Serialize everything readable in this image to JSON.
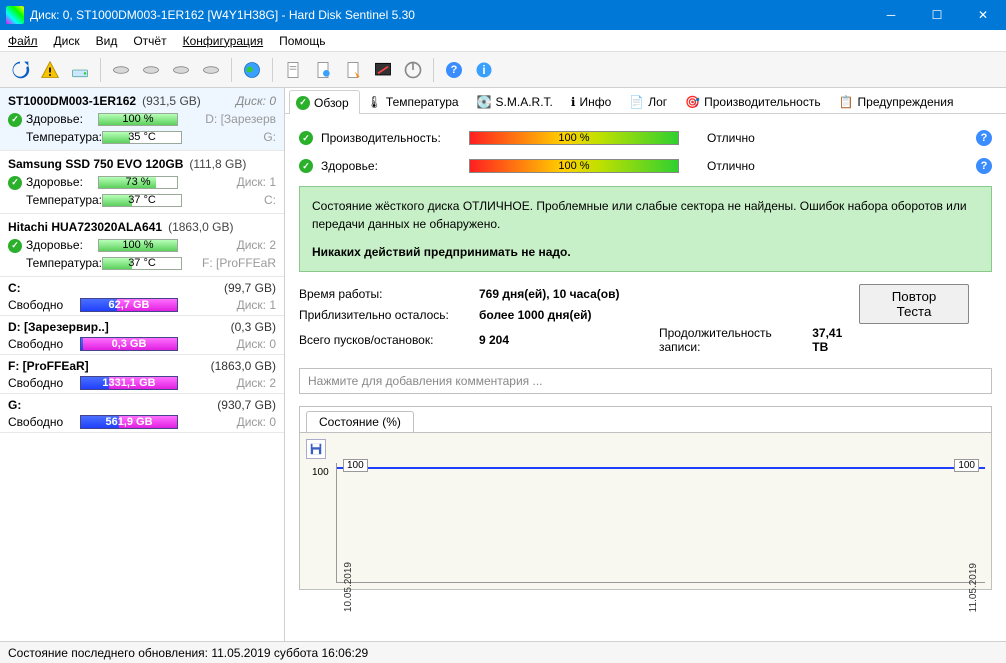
{
  "title": "Диск: 0, ST1000DM003-1ER162 [W4Y1H38G]  -  Hard Disk Sentinel 5.30",
  "menu": {
    "file": "Файл",
    "disk": "Диск",
    "view": "Вид",
    "report": "Отчёт",
    "config": "Конфигурация",
    "help": "Помощь"
  },
  "disks": [
    {
      "name": "ST1000DM003-1ER162",
      "size": "(931,5 GB)",
      "ord": "Диск: 0",
      "selected": true,
      "health_lbl": "Здоровье:",
      "health_val": "100 %",
      "health_pct": 100,
      "temp_lbl": "Температура:",
      "temp_val": "35 °C",
      "temp_pct": 35,
      "r1": "D: [Зарезерв",
      "r2": "G:"
    },
    {
      "name": "Samsung SSD 750 EVO 120GB",
      "size": "(111,8 GB)",
      "ord": "",
      "health_lbl": "Здоровье:",
      "health_val": "73 %",
      "health_pct": 73,
      "temp_lbl": "Температура:",
      "temp_val": "37 °C",
      "temp_pct": 37,
      "r1": "Диск: 1",
      "r2": "C:"
    },
    {
      "name": "Hitachi HUA723020ALA641",
      "size": "(1863,0 GB)",
      "ord": "",
      "health_lbl": "Здоровье:",
      "health_val": "100 %",
      "health_pct": 100,
      "temp_lbl": "Температура:",
      "temp_val": "37 °C",
      "temp_pct": 37,
      "r1": "Диск: 2",
      "r2": "F: [ProFFEaR"
    }
  ],
  "volumes": [
    {
      "name": "C:",
      "size": "(99,7 GB)",
      "free_lbl": "Свободно",
      "free_val": "62,7 GB",
      "free_pct": 63,
      "ord": "Диск: 1"
    },
    {
      "name": "D: [Зарезервир..]",
      "size": "(0,3 GB)",
      "free_lbl": "Свободно",
      "free_val": "0,3 GB",
      "free_pct": 98,
      "ord": "Диск: 0"
    },
    {
      "name": "F: [ProFFEaR]",
      "size": "(1863,0 GB)",
      "free_lbl": "Свободно",
      "free_val": "1331,1 GB",
      "free_pct": 71,
      "ord": "Диск: 2"
    },
    {
      "name": "G:",
      "size": "(930,7 GB)",
      "free_lbl": "Свободно",
      "free_val": "561,9 GB",
      "free_pct": 60,
      "ord": "Диск: 0"
    }
  ],
  "tabs": {
    "overview": "Обзор",
    "temp": "Температура",
    "smart": "S.M.A.R.T.",
    "info": "Инфо",
    "log": "Лог",
    "perf": "Производительность",
    "alerts": "Предупреждения"
  },
  "overview": {
    "perf_lbl": "Производительность:",
    "perf_val": "100 %",
    "perf_verdict": "Отлично",
    "health_lbl": "Здоровье:",
    "health_val": "100 %",
    "health_verdict": "Отлично",
    "green_line1": "Состояние жёсткого диска ОТЛИЧНОЕ. Проблемные или слабые сектора не найдены. Ошибок набора оборотов или передачи данных не обнаружено.",
    "green_line2": "Никаких действий предпринимать не надо.",
    "uptime_lbl": "Время работы:",
    "uptime_val": "769 дня(ей), 10 часа(ов)",
    "remain_lbl": "Приблизительно осталось:",
    "remain_val": "более 1000 дня(ей)",
    "starts_lbl": "Всего пусков/остановок:",
    "starts_val": "9 204",
    "write_lbl": "Продолжительность записи:",
    "write_val": "37,41 TB",
    "retest": "Повтор Теста",
    "comment_placeholder": "Нажмите для добавления комментария ...",
    "chart_title": "Состояние (%)",
    "chart_ytick": "100",
    "chart_point_a": "100",
    "chart_point_b": "100",
    "chart_date_a": "10.05.2019",
    "chart_date_b": "11.05.2019"
  },
  "chart_data": {
    "type": "line",
    "title": "Состояние (%)",
    "ylabel": "",
    "xlabel": "",
    "ylim": [
      0,
      100
    ],
    "x": [
      "10.05.2019",
      "11.05.2019"
    ],
    "values": [
      100,
      100
    ]
  },
  "statusbar": "Состояние последнего обновления: 11.05.2019 суббота 16:06:29"
}
